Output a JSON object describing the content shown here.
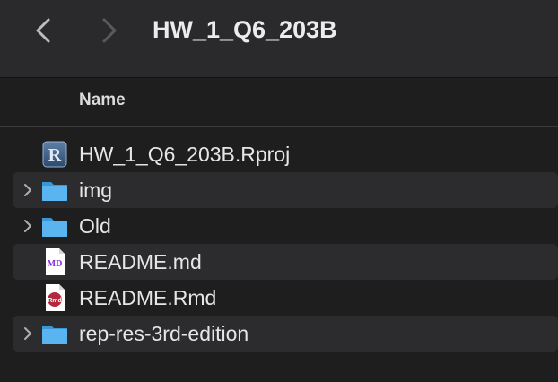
{
  "window": {
    "title": "HW_1_Q6_203B"
  },
  "toolbar": {
    "back_icon": "chevron-left-icon",
    "forward_icon": "chevron-right-icon"
  },
  "columns": {
    "name": "Name"
  },
  "files": [
    {
      "name": "HW_1_Q6_203B.Rproj",
      "icon": "rproj-file-icon",
      "type": "file"
    },
    {
      "name": "img",
      "icon": "folder-icon",
      "type": "folder"
    },
    {
      "name": "Old",
      "icon": "folder-icon",
      "type": "folder"
    },
    {
      "name": "README.md",
      "icon": "markdown-file-icon",
      "type": "file",
      "icon_text": "MD"
    },
    {
      "name": "README.Rmd",
      "icon": "rmarkdown-file-icon",
      "type": "file",
      "icon_text": "Rmd"
    },
    {
      "name": "rep-res-3rd-edition",
      "icon": "folder-icon",
      "type": "folder"
    }
  ],
  "colors": {
    "background": "#1e1e1e",
    "toolbar": "#2a2a2c",
    "row_alt": "#2c2c2e",
    "folder": "#4aa8e8",
    "md_accent": "#8a2be2",
    "rmd_accent": "#b5283b"
  }
}
